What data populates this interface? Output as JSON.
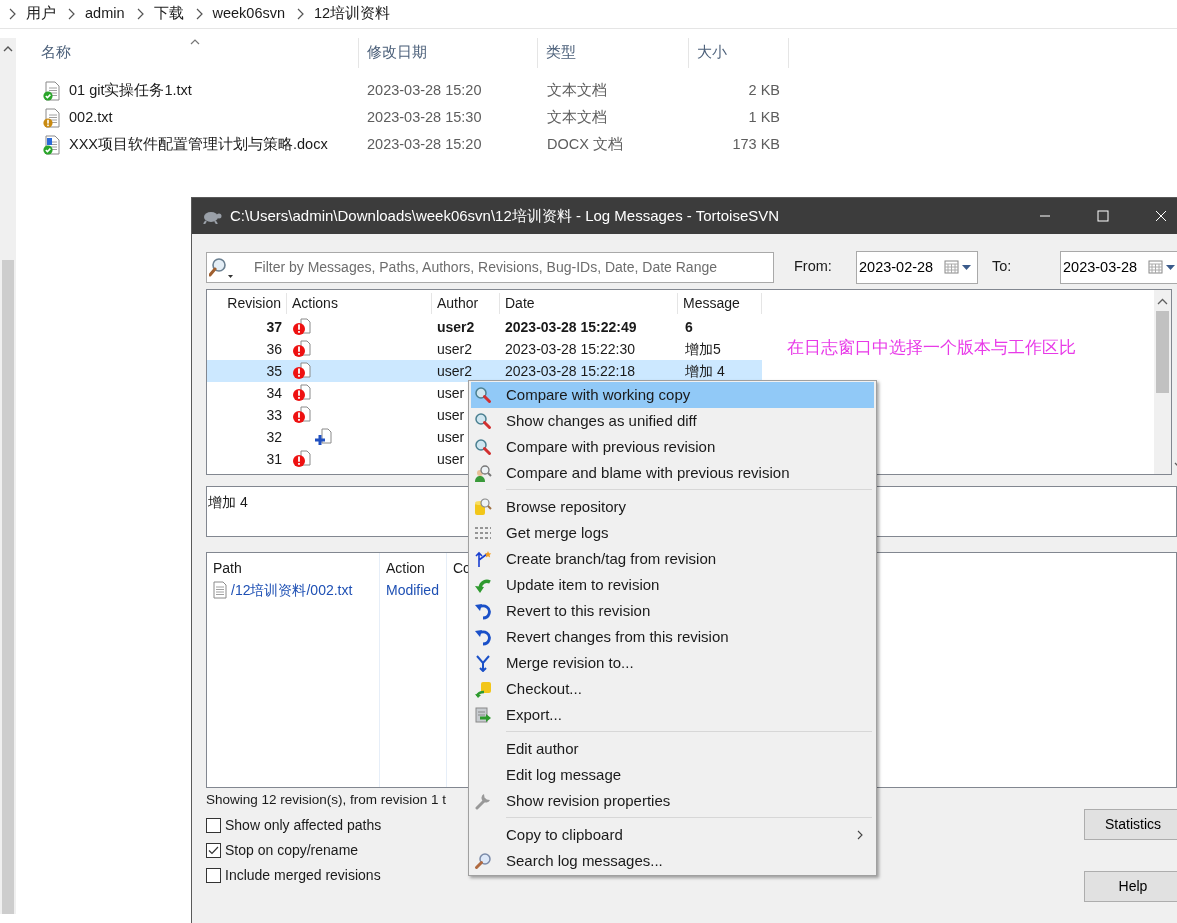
{
  "explorer": {
    "breadcrumb": [
      "用户",
      "admin",
      "下载",
      "week06svn",
      "12培训资料"
    ],
    "columns": [
      "名称",
      "修改日期",
      "类型",
      "大小"
    ],
    "files": [
      {
        "name": "01 git实操任务1.txt",
        "date": "2023-03-28 15:20",
        "type": "文本文档",
        "size": "2 KB",
        "kind": "text",
        "modified": false
      },
      {
        "name": "002.txt",
        "date": "2023-03-28 15:30",
        "type": "文本文档",
        "size": "1 KB",
        "kind": "text",
        "modified": true
      },
      {
        "name": "XXX项目软件配置管理计划与策略.docx",
        "date": "2023-03-28 15:20",
        "type": "DOCX 文档",
        "size": "173 KB",
        "kind": "docx",
        "modified": false
      }
    ]
  },
  "log_window": {
    "title": "C:\\Users\\admin\\Downloads\\week06svn\\12培训资料 - Log Messages - TortoiseSVN",
    "filter": {
      "placeholder": "Filter by Messages, Paths, Authors, Revisions, Bug-IDs, Date, Date Range"
    },
    "from": {
      "label": "From:",
      "value": "2023-02-28"
    },
    "to": {
      "label": "To:",
      "value": "2023-03-28"
    },
    "revisions": {
      "columns": [
        "Revision",
        "Actions",
        "Author",
        "Date",
        "Message"
      ],
      "rows": [
        {
          "revision": "37",
          "kind": "modified",
          "author": "user2",
          "date": "2023-03-28 15:22:49",
          "message": "6",
          "bold": true,
          "selected": false
        },
        {
          "revision": "36",
          "kind": "modified",
          "author": "user2",
          "date": "2023-03-28 15:22:30",
          "message": "增加5",
          "bold": false,
          "selected": false
        },
        {
          "revision": "35",
          "kind": "modified",
          "author": "user2",
          "date": "2023-03-28 15:22:18",
          "message": "增加 4",
          "bold": false,
          "selected": true
        },
        {
          "revision": "34",
          "kind": "modified",
          "author": "user",
          "bold": false,
          "selected": false
        },
        {
          "revision": "33",
          "kind": "modified",
          "author": "user",
          "bold": false,
          "selected": false
        },
        {
          "revision": "32",
          "kind": "added",
          "author": "user",
          "bold": false,
          "selected": false
        },
        {
          "revision": "31",
          "kind": "modified",
          "author": "user",
          "bold": false,
          "selected": false
        }
      ]
    },
    "annotation": "在日志窗口中选择一个版本与工作区比",
    "message": "增加 4",
    "paths": {
      "columns": [
        "Path",
        "Action",
        "Co"
      ],
      "rows": [
        {
          "path": "/12培训资料/002.txt",
          "action": "Modified"
        }
      ]
    },
    "status": "Showing 12 revision(s), from revision 1 t",
    "options": [
      {
        "label": "Show only affected paths",
        "checked": false
      },
      {
        "label": "Stop on copy/rename",
        "checked": true
      },
      {
        "label": "Include merged revisions",
        "checked": false
      }
    ],
    "buttons": [
      "Statistics",
      "Help"
    ]
  },
  "context_menu": {
    "groups": [
      [
        {
          "label": "Compare with working copy",
          "kind": "diff",
          "selected": true
        },
        {
          "label": "Show changes as unified diff",
          "kind": "diff",
          "selected": false
        },
        {
          "label": "Compare with previous revision",
          "kind": "diff",
          "selected": false
        },
        {
          "label": "Compare and blame with previous revision",
          "kind": "blame",
          "selected": false
        }
      ],
      [
        {
          "label": "Browse repository",
          "kind": "repo",
          "selected": false
        },
        {
          "label": "Get merge logs",
          "kind": "merge-logs",
          "selected": false
        },
        {
          "label": "Create branch/tag from revision",
          "kind": "branch",
          "selected": false
        },
        {
          "label": "Update item to revision",
          "kind": "update",
          "selected": false
        },
        {
          "label": "Revert to this revision",
          "kind": "revert",
          "selected": false
        },
        {
          "label": "Revert changes from this revision",
          "kind": "revert",
          "selected": false
        },
        {
          "label": "Merge revision to...",
          "kind": "merge",
          "selected": false
        },
        {
          "label": "Checkout...",
          "kind": "checkout",
          "selected": false
        },
        {
          "label": "Export...",
          "kind": "export",
          "selected": false
        }
      ],
      [
        {
          "label": "Edit author",
          "kind": "plain",
          "selected": false
        },
        {
          "label": "Edit log message",
          "kind": "plain",
          "selected": false
        },
        {
          "label": "Show revision properties",
          "kind": "wrench",
          "selected": false
        }
      ],
      [
        {
          "label": "Copy to clipboard",
          "kind": "plain",
          "submenu": true,
          "selected": false
        },
        {
          "label": "Search log messages...",
          "kind": "search",
          "selected": false
        }
      ]
    ]
  }
}
